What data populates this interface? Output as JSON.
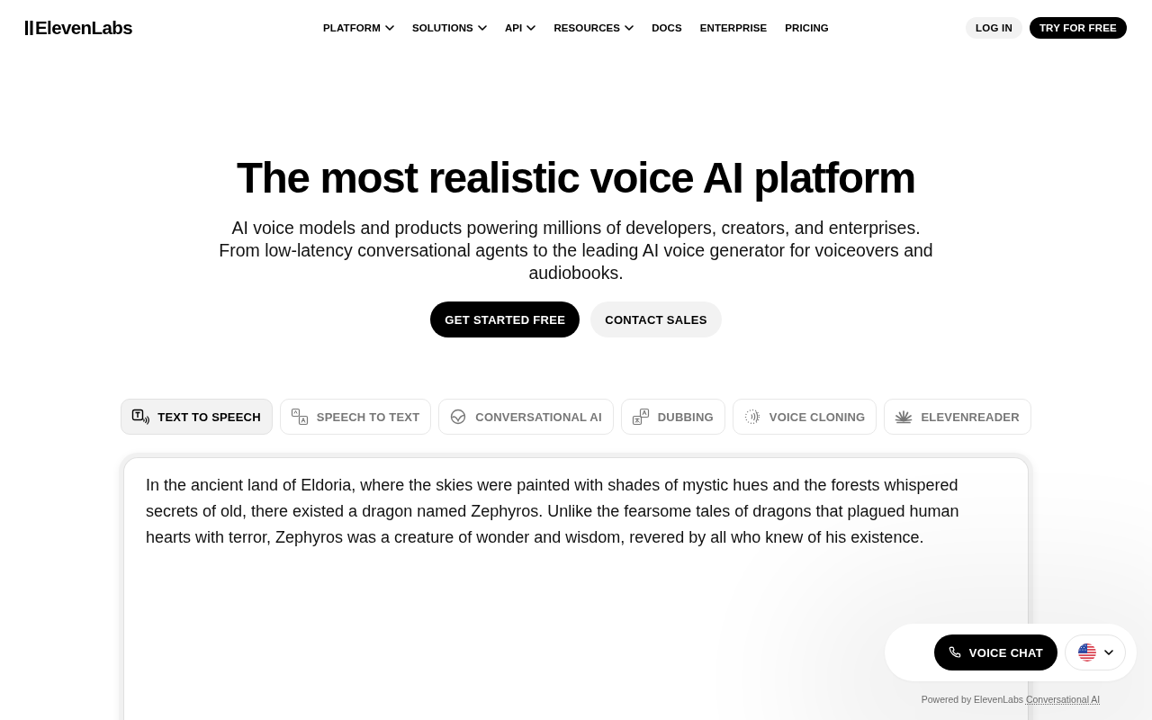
{
  "header": {
    "logo": "ElevenLabs",
    "nav": [
      {
        "label": "PLATFORM",
        "dropdown": true
      },
      {
        "label": "SOLUTIONS",
        "dropdown": true
      },
      {
        "label": "API",
        "dropdown": true
      },
      {
        "label": "RESOURCES",
        "dropdown": true
      },
      {
        "label": "DOCS",
        "dropdown": false
      },
      {
        "label": "ENTERPRISE",
        "dropdown": false
      },
      {
        "label": "PRICING",
        "dropdown": false
      }
    ],
    "actions": [
      {
        "label": "LOG IN",
        "kind": "secondary"
      },
      {
        "label": "TRY FOR FREE",
        "kind": "primary"
      }
    ]
  },
  "hero": {
    "title": "The most realistic voice AI platform",
    "subtitle": [
      "AI voice models and products powering millions of developers, creators, and enterprises.",
      "From low-latency conversational agents to the leading AI voice generator for voiceovers and audiobooks."
    ],
    "buttons": [
      {
        "label": "GET STARTED FREE",
        "kind": "primary"
      },
      {
        "label": "CONTACT SALES",
        "kind": "secondary"
      }
    ]
  },
  "product_tabs": [
    {
      "label": "TEXT TO SPEECH",
      "selected": true
    },
    {
      "label": "SPEECH TO TEXT",
      "selected": false
    },
    {
      "label": "CONVERSATIONAL AI",
      "selected": false
    },
    {
      "label": "DUBBING",
      "selected": false
    },
    {
      "label": "VOICE CLONING",
      "selected": false
    },
    {
      "label": "ELEVENREADER",
      "selected": false
    }
  ],
  "editor": {
    "text": "In the ancient land of Eldoria, where the skies were painted with shades of mystic hues and the forests whispered secrets of old, there existed a dragon named Zephyros. Unlike the fearsome tales of dragons that plagued human hearts with terror, Zephyros was a creature of wonder and wisdom, revered by all who knew of his existence."
  },
  "voice_widget": {
    "button": "VOICE CHAT",
    "powered_by": "Powered by ElevenLabs",
    "powered_by_link": "Conversational AI"
  }
}
